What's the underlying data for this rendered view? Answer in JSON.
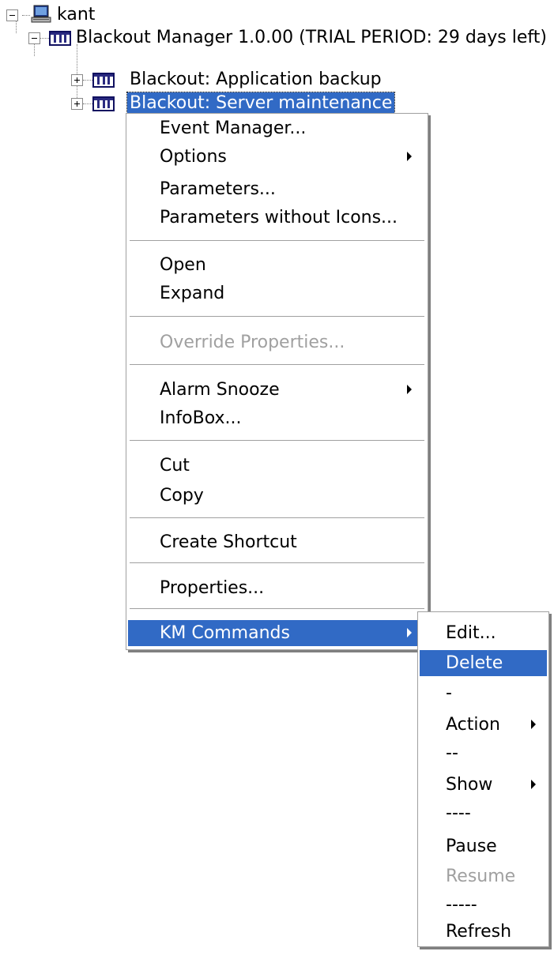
{
  "tree": {
    "root_label": "kant",
    "manager_label": "Blackout Manager 1.0.00 (TRIAL PERIOD: 29 days left)",
    "items": [
      {
        "label": "Blackout: Application backup"
      },
      {
        "label": "Blackout: Server maintenance"
      }
    ]
  },
  "context_menu": {
    "event_manager": "Event Manager...",
    "options": "Options",
    "parameters": "Parameters...",
    "parameters_no_icons": "Parameters without Icons...",
    "open": "Open",
    "expand": "Expand",
    "override_properties": "Override Properties...",
    "alarm_snooze": "Alarm Snooze",
    "infobox": "InfoBox...",
    "cut": "Cut",
    "copy": "Copy",
    "create_shortcut": "Create Shortcut",
    "properties": "Properties...",
    "km_commands": "KM Commands"
  },
  "submenu": {
    "edit": "Edit...",
    "delete": "Delete",
    "sep1": "-",
    "action": "Action",
    "sep2": "--",
    "show": "Show",
    "sep3": "----",
    "pause": "Pause",
    "resume": "Resume",
    "sep4": "-----",
    "refresh": "Refresh"
  },
  "colors": {
    "highlight": "#316ac5",
    "disabled_text": "#a0a0a0"
  }
}
